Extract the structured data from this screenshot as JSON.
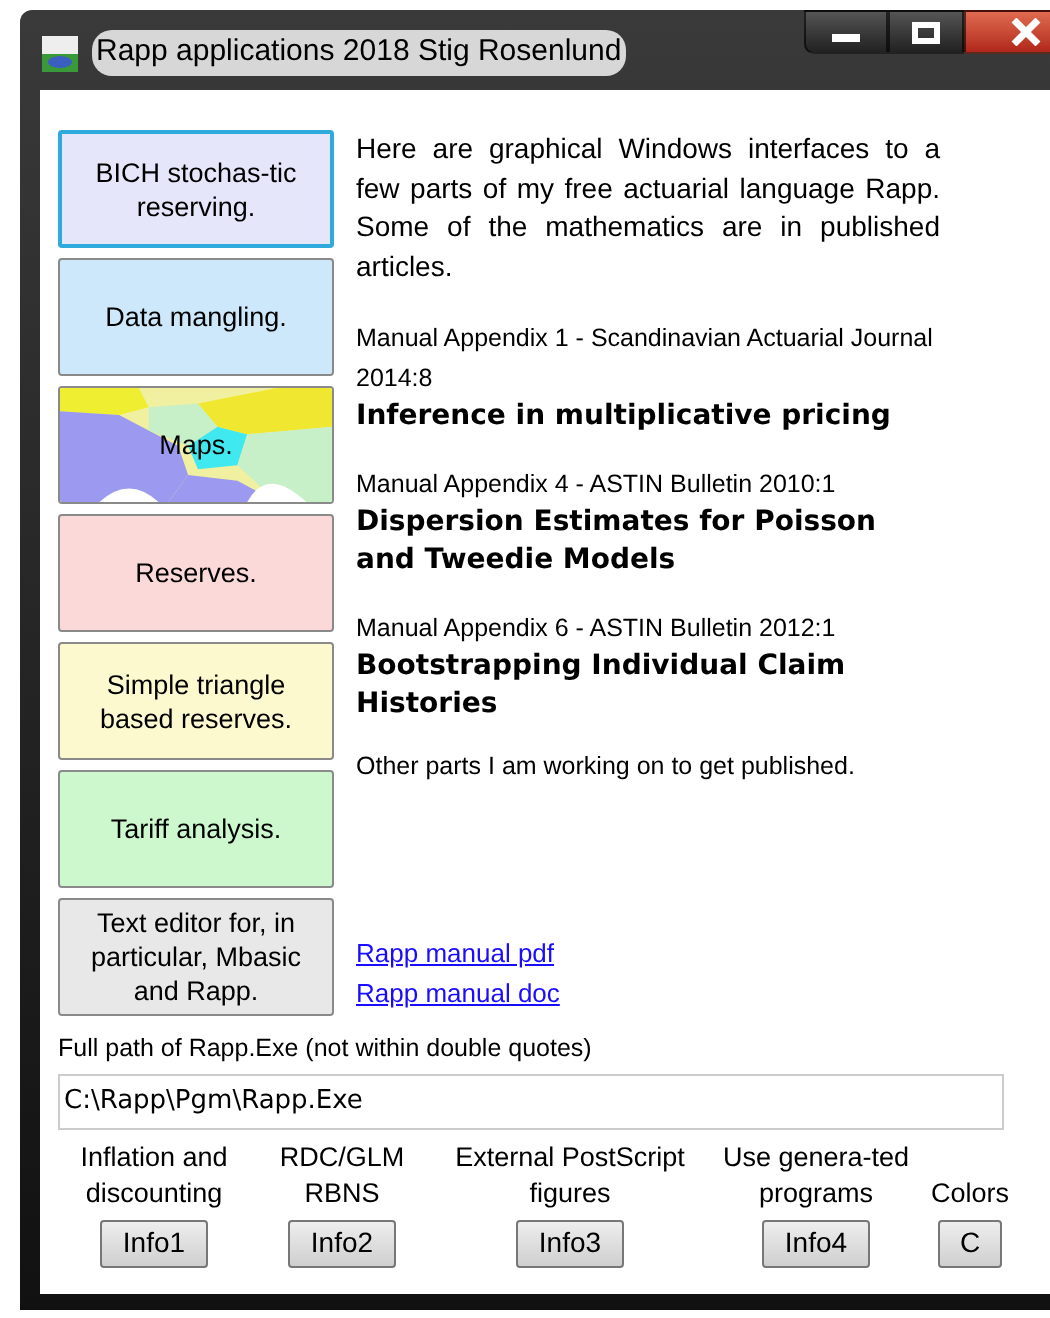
{
  "window": {
    "title": "Rapp applications  2018 Stig Rosenlund"
  },
  "app_buttons": [
    {
      "label": "BICH stochas-tic reserving.",
      "kind": "plain",
      "color": "#e6e6fa",
      "focused": true
    },
    {
      "label": "Data mangling.",
      "kind": "plain",
      "color": "#cde8fa",
      "focused": false
    },
    {
      "label": "Maps.",
      "kind": "map",
      "focused": false
    },
    {
      "label": "Reserves.",
      "kind": "plain",
      "color": "#fcd9d9",
      "focused": false
    },
    {
      "label": "Simple triangle based reserves.",
      "kind": "plain",
      "color": "#fdf9cf",
      "focused": false
    },
    {
      "label": "Tariff analysis.",
      "kind": "plain",
      "color": "#cdf8cd",
      "focused": false
    },
    {
      "label": "Text editor for, in particular, Mbasic and Rapp.",
      "kind": "plain",
      "color": "#e8e8e8",
      "focused": false
    }
  ],
  "intro": "Here are graphical Windows interfaces to a  few parts of my free actuarial language Rapp. Some of the mathematics are in published articles.",
  "articles": [
    {
      "source": "Manual Appendix 1 - Scandinavian Actuarial Journal 2014:8",
      "title": "Inference in multiplicative pricing"
    },
    {
      "source": "Manual Appendix 4 - ASTIN Bulletin 2010:1",
      "title": "Dispersion Estimates for Poisson and Tweedie Models"
    },
    {
      "source": "Manual Appendix 6 - ASTIN Bulletin 2012:1",
      "title": "Bootstrapping Individual Claim Histories"
    }
  ],
  "note": "Other parts I am working on to get published.",
  "links": [
    "Rapp manual pdf",
    "Rapp manual doc"
  ],
  "path_field": {
    "label": "Full path of Rapp.Exe (not within double quotes)",
    "value": "C:\\Rapp\\Pgm\\Rapp.Exe"
  },
  "info_buttons": [
    {
      "caption": "Inflation and discounting",
      "label": "Info1"
    },
    {
      "caption": "RDC/GLM RBNS",
      "label": "Info2"
    },
    {
      "caption": "External PostScript figures",
      "label": "Info3"
    },
    {
      "caption": "Use genera-ted programs",
      "label": "Info4"
    },
    {
      "caption": "Colors",
      "label": "C"
    }
  ]
}
